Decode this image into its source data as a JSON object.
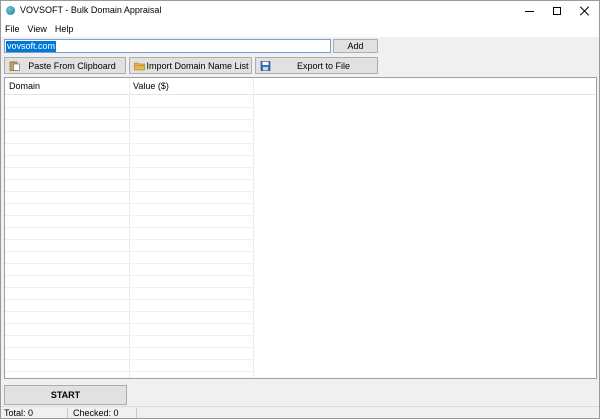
{
  "window": {
    "title": "VOVSOFT - Bulk Domain Appraisal"
  },
  "menu": {
    "items": [
      "File",
      "View",
      "Help"
    ]
  },
  "toolbar": {
    "domain_value": "vovsoft.com",
    "add_label": "Add",
    "paste_label": "Paste From Clipboard",
    "import_label": "Import Domain Name List",
    "export_label": "Export to File"
  },
  "table": {
    "columns": [
      "Domain",
      "Value ($)"
    ],
    "rows": []
  },
  "actions": {
    "start_label": "START"
  },
  "status": {
    "total": "Total: 0",
    "checked": "Checked: 0"
  },
  "colors": {
    "selection": "#0078d7",
    "button_face": "#e1e1e1",
    "window_bg": "#f0f0f0"
  },
  "icons": [
    "app-icon",
    "minimize-icon",
    "maximize-icon",
    "close-icon",
    "clipboard-icon",
    "folder-icon",
    "save-icon"
  ]
}
